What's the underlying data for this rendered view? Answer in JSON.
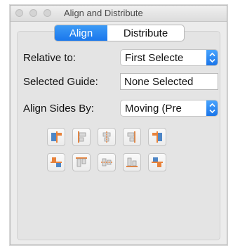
{
  "window": {
    "title": "Align and Distribute"
  },
  "tabs": [
    {
      "label": "Align",
      "active": true
    },
    {
      "label": "Distribute",
      "active": false
    }
  ],
  "fields": {
    "relative_to": {
      "label": "Relative to:",
      "value": "First Selecte"
    },
    "selected_guide": {
      "label": "Selected Guide:",
      "value": "None Selected"
    },
    "align_sides_by": {
      "label": "Align Sides By:",
      "value": "Moving (Pre"
    }
  },
  "align_buttons": {
    "row1": [
      "align-left-edges-icon",
      "align-left-sides-icon",
      "align-horizontal-centers-icon",
      "align-right-sides-icon",
      "align-right-edges-icon"
    ],
    "row2": [
      "align-top-edges-icon",
      "align-top-sides-icon",
      "align-vertical-centers-icon",
      "align-bottom-sides-icon",
      "align-bottom-edges-icon"
    ]
  },
  "colors": {
    "accent": "#1a77ec",
    "icon_orange": "#e8823a",
    "icon_blue": "#4e86c6"
  }
}
